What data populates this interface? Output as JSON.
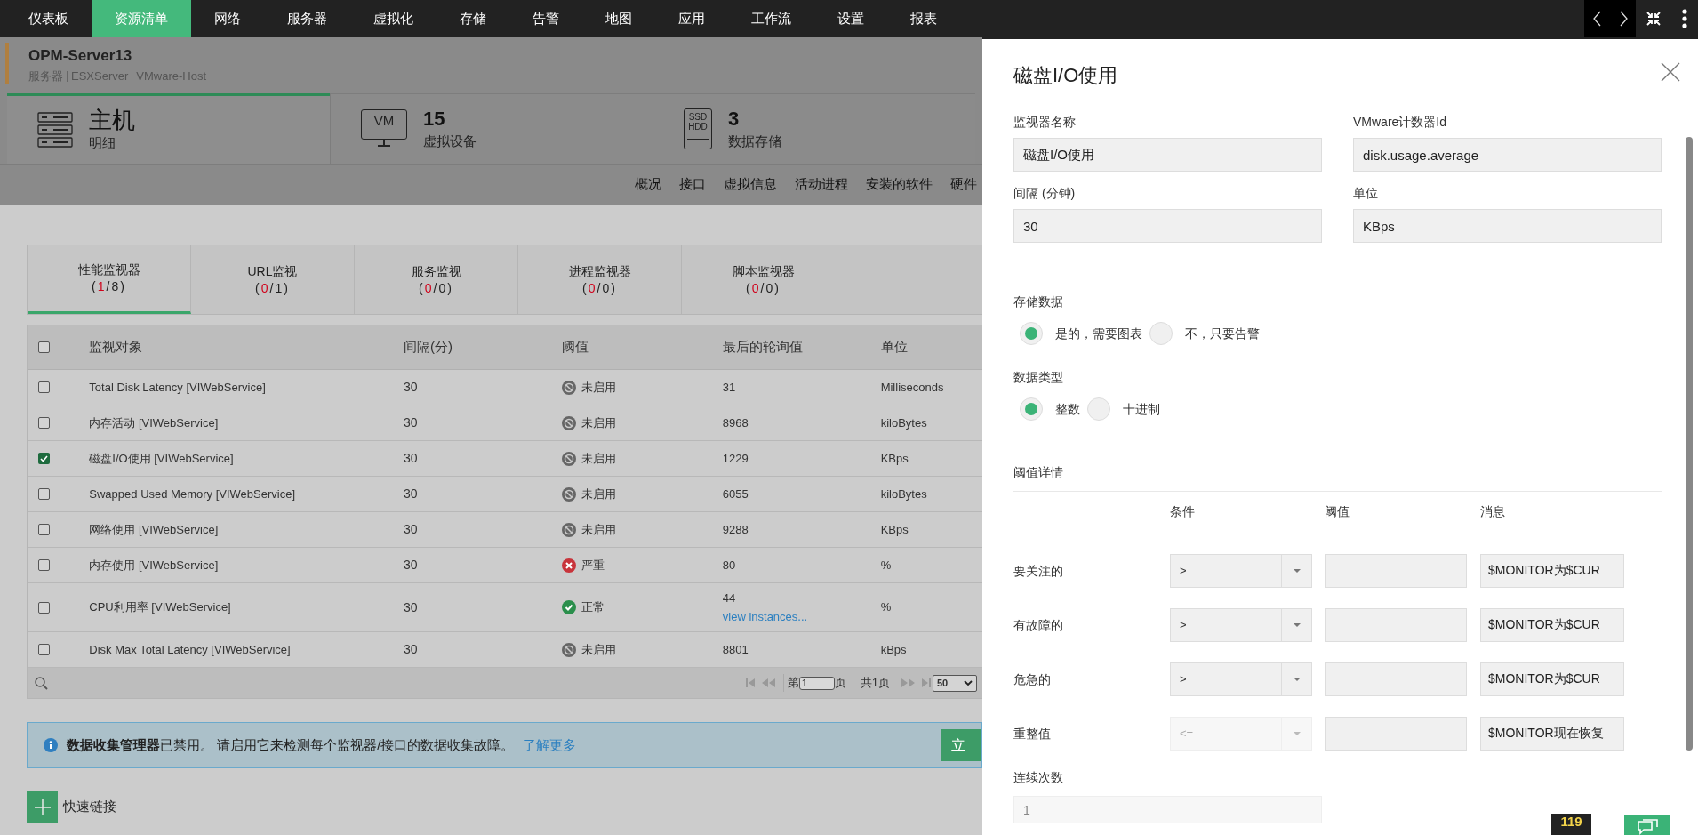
{
  "nav": [
    {
      "label": "仪表板",
      "selected": false
    },
    {
      "label": "资源清单",
      "selected": true
    },
    {
      "label": "网络",
      "selected": false
    },
    {
      "label": "服务器",
      "selected": false
    },
    {
      "label": "虚拟化",
      "selected": false
    },
    {
      "label": "存储",
      "selected": false
    },
    {
      "label": "告警",
      "selected": false
    },
    {
      "label": "地图",
      "selected": false
    },
    {
      "label": "应用",
      "selected": false
    },
    {
      "label": "工作流",
      "selected": false
    },
    {
      "label": "设置",
      "selected": false
    },
    {
      "label": "报表",
      "selected": false
    }
  ],
  "header": {
    "title": "OPM-Server13",
    "breadcrumb": [
      "服务器",
      "ESXServer",
      "VMware-Host"
    ]
  },
  "summary_tabs": [
    {
      "kind": "host",
      "value": "主机",
      "label": "明细",
      "selected": true
    },
    {
      "kind": "vm",
      "icon_text": [
        "VM"
      ],
      "value": "15",
      "label": "虚拟设备",
      "selected": false
    },
    {
      "kind": "storage",
      "icon_text": [
        "SSD",
        "HDD"
      ],
      "value": "3",
      "label": "数据存储",
      "selected": false
    }
  ],
  "subnav": [
    "概况",
    "接口",
    "虚拟信息",
    "活动进程",
    "安装的软件",
    "硬件"
  ],
  "monitor_tabs": [
    {
      "label": "性能监视器",
      "count_before": "(",
      "count_alert": "1",
      "count_after": "/8)",
      "selected": true
    },
    {
      "label": "URL监视",
      "count_before": "(",
      "count_alert": "0",
      "count_after": "/1)",
      "selected": false
    },
    {
      "label": "服务监视",
      "count_before": "(",
      "count_alert": "0",
      "count_after": "/0)",
      "selected": false
    },
    {
      "label": "进程监视器",
      "count_before": "(",
      "count_alert": "0",
      "count_after": "/0)",
      "selected": false
    },
    {
      "label": "脚本监视器",
      "count_before": "(",
      "count_alert": "0",
      "count_after": "/0)",
      "selected": false
    }
  ],
  "table": {
    "select_all": false,
    "columns": [
      "监视对象",
      "间隔(分)",
      "阈值",
      "最后的轮询值",
      "单位"
    ],
    "rows": [
      {
        "checked": false,
        "name": "Total Disk Latency [VIWebService]",
        "interval": "30",
        "kind": "disabled",
        "threshold": "未启用",
        "last_value": "31",
        "unit": "Milliseconds"
      },
      {
        "checked": false,
        "name": "内存活动 [VIWebService]",
        "interval": "30",
        "kind": "disabled",
        "threshold": "未启用",
        "last_value": "8968",
        "unit": "kiloBytes"
      },
      {
        "checked": true,
        "name": "磁盘I/O使用 [VIWebService]",
        "interval": "30",
        "kind": "disabled",
        "threshold": "未启用",
        "last_value": "1229",
        "unit": "KBps"
      },
      {
        "checked": false,
        "name": "Swapped Used Memory [VIWebService]",
        "interval": "30",
        "kind": "disabled",
        "threshold": "未启用",
        "last_value": "6055",
        "unit": "kiloBytes"
      },
      {
        "checked": false,
        "name": "网络使用 [VIWebService]",
        "interval": "30",
        "kind": "disabled",
        "threshold": "未启用",
        "last_value": "9288",
        "unit": "KBps"
      },
      {
        "checked": false,
        "name": "内存使用 [VIWebService]",
        "interval": "30",
        "kind": "critical",
        "threshold": "严重",
        "last_value": "80",
        "unit": "%"
      },
      {
        "checked": false,
        "name": "CPU利用率 [VIWebService]",
        "interval": "30",
        "kind": "clear",
        "threshold": "正常",
        "last_value": "44",
        "link": "view instances...",
        "unit": "%"
      },
      {
        "checked": false,
        "name": "Disk Max Total Latency [VIWebService]",
        "interval": "30",
        "kind": "disabled",
        "threshold": "未启用",
        "last_value": "8801",
        "unit": "kBps"
      }
    ],
    "pagination": {
      "page_before": "第",
      "page": "1",
      "page_after": "页",
      "total": "共1页",
      "per_page": "50"
    }
  },
  "banner": {
    "text": "**数据收集管理器**已禁用。 请启用它来检测每个监视器/接口的数据收集故障。",
    "link": "了解更多",
    "button": "立"
  },
  "quick_links": "快速链接",
  "panel": {
    "title": "磁盘I/O使用",
    "fields": [
      {
        "label": "监视器名称",
        "value": "磁盘I/O使用"
      },
      {
        "label": "VMware计数器Id",
        "value": "disk.usage.average"
      },
      {
        "label": "间隔 (分钟)",
        "value": "30"
      },
      {
        "label": "单位",
        "value": "KBps"
      }
    ],
    "radio_groups": [
      {
        "label": "存储数据",
        "options": [
          {
            "label": "是的，需要图表",
            "selected": true
          },
          {
            "label": "不，只要告警",
            "selected": false
          }
        ]
      },
      {
        "label": "数据类型",
        "options": [
          {
            "label": "整数",
            "selected": true
          },
          {
            "label": "十进制",
            "selected": false
          }
        ]
      }
    ],
    "threshold": {
      "title": "阈值详情",
      "columns": [
        "条件",
        "阈值",
        "消息"
      ],
      "rows": [
        {
          "label": "要关注的",
          "condition": ">",
          "disabled": false,
          "message": "$MONITOR为$CUR"
        },
        {
          "label": "有故障的",
          "condition": ">",
          "disabled": false,
          "message": "$MONITOR为$CUR"
        },
        {
          "label": "危急的",
          "condition": ">",
          "disabled": false,
          "message": "$MONITOR为$CUR"
        },
        {
          "label": "重整值",
          "condition": "<=",
          "disabled": true,
          "message": "$MONITOR现在恢复"
        }
      ]
    },
    "consecutive": {
      "label": "连续次数",
      "placeholder": "1"
    },
    "alarm_badge": {
      "count": "119"
    }
  }
}
